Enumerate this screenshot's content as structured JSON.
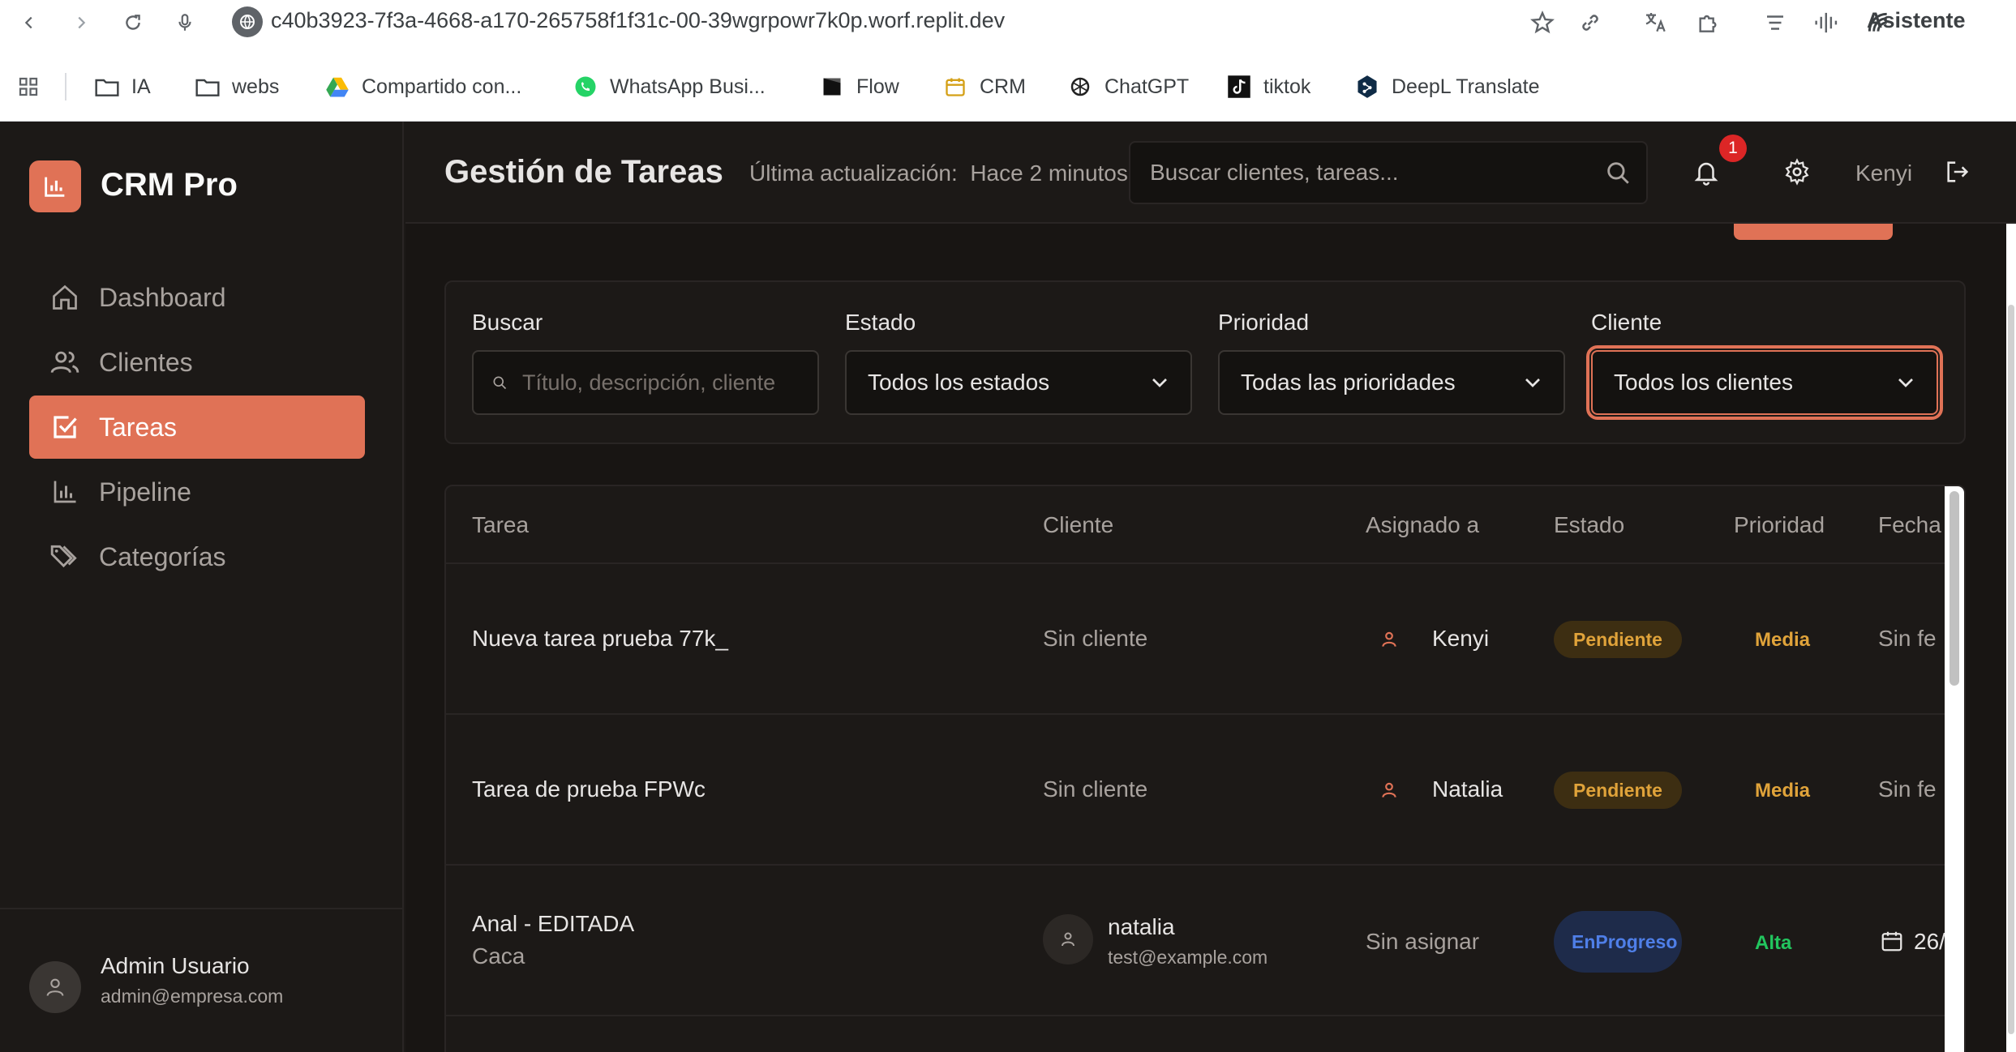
{
  "browser": {
    "url": "c40b3923-7f3a-4668-a170-265758f1f31c-00-39wgrpowr7k0p.worf.replit.dev",
    "assistant_label": "Asistente",
    "bookmarks": [
      {
        "label": "IA",
        "icon": "folder-icon"
      },
      {
        "label": "webs",
        "icon": "folder-icon"
      },
      {
        "label": "Compartido con...",
        "icon": "google-drive-icon"
      },
      {
        "label": "WhatsApp Busi...",
        "icon": "whatsapp-icon"
      },
      {
        "label": "Flow",
        "icon": "flow-icon"
      },
      {
        "label": "CRM",
        "icon": "calendar-icon"
      },
      {
        "label": "ChatGPT",
        "icon": "chatgpt-icon"
      },
      {
        "label": "tiktok",
        "icon": "tiktok-icon"
      },
      {
        "label": "DeepL Translate",
        "icon": "deepl-icon"
      }
    ]
  },
  "app": {
    "name": "CRM Pro",
    "accent": "#e07256"
  },
  "sidebar": {
    "items": [
      {
        "label": "Dashboard",
        "icon": "home-icon"
      },
      {
        "label": "Clientes",
        "icon": "users-icon"
      },
      {
        "label": "Tareas",
        "icon": "checkbox-icon",
        "active": true
      },
      {
        "label": "Pipeline",
        "icon": "bar-chart-icon"
      },
      {
        "label": "Categorías",
        "icon": "tags-icon"
      }
    ],
    "user": {
      "name": "Admin Usuario",
      "email": "admin@empresa.com"
    }
  },
  "header": {
    "title": "Gestión de Tareas",
    "updated": "Última actualización:  Hace 2 minutos",
    "search_placeholder": "Buscar clientes, tareas...",
    "notifications": "1",
    "user": "Kenyi"
  },
  "filters": {
    "search_label": "Buscar",
    "search_placeholder": "Título, descripción, cliente",
    "status_label": "Estado",
    "status_value": "Todos los estados",
    "priority_label": "Prioridad",
    "priority_value": "Todas las prioridades",
    "client_label": "Cliente",
    "client_value": "Todos los clientes"
  },
  "table": {
    "headers": [
      "Tarea",
      "Cliente",
      "Asignado a",
      "Estado",
      "Prioridad",
      "Fecha"
    ],
    "rows": [
      {
        "task": "Nueva tarea prueba 77k_",
        "subtitle": "",
        "client": "Sin cliente",
        "client_email": "",
        "assignee": "Kenyi",
        "status": "Pendiente",
        "priority": "Media",
        "date": "Sin fe"
      },
      {
        "task": "Tarea de prueba FPWc",
        "subtitle": "",
        "client": "Sin cliente",
        "client_email": "",
        "assignee": "Natalia",
        "status": "Pendiente",
        "priority": "Media",
        "date": "Sin fe"
      },
      {
        "task": "Anal - EDITADA",
        "subtitle": "Caca",
        "client": "natalia",
        "client_email": "test@example.com",
        "assignee": "Sin asignar",
        "status_line1": "En",
        "status_line2": "Progreso",
        "priority": "Alta",
        "date": "26/"
      }
    ],
    "colors": {
      "pending": "#e0a33a",
      "progress": "#4f7fe8",
      "media": "#e0a33a",
      "alta": "#22c55e"
    }
  }
}
